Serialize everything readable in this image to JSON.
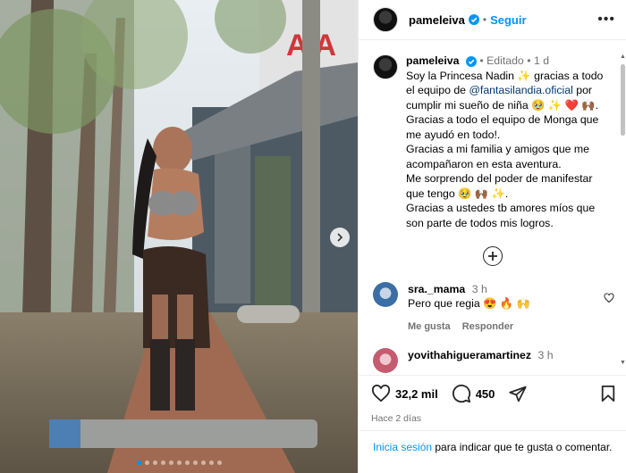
{
  "post": {
    "username": "pameleiva",
    "follow_label": "Seguir",
    "more_label": "•••",
    "edited_label": "Editado",
    "age": "1 d",
    "caption_lines": [
      "Soy la Princesa Nadin ✨ gracias a todo",
      "el equipo de ",
      "@fantasilandia.oficial",
      " por",
      "cumplir mi sueño de niña 🥹 ✨ ❤️ 🙌🏾.",
      "Gracias a todo el equipo de Monga que",
      "me ayudó en todo!.",
      "Gracias a mi familia y amigos que me",
      "acompañaron en esta aventura.",
      "Me sorprendo del poder de manifestar",
      "que tengo 🥹 🙌🏾 ✨.",
      "Gracias a ustedes tb amores míos que",
      "son parte de todos mis logros."
    ]
  },
  "comments": [
    {
      "username": "sra._mama",
      "time": "3 h",
      "text": "Pero que regia 😍 🔥 🙌",
      "like_label": "Me gusta",
      "reply_label": "Responder"
    },
    {
      "username": "yovithahigueramartinez",
      "time": "3 h"
    }
  ],
  "stats": {
    "likes": "32,2 mil",
    "comments": "450",
    "date": "Hace 2 días"
  },
  "login": {
    "link": "Inicia sesión",
    "text": " para indicar que te gusta o comentar."
  },
  "photo": {
    "sign_text": "A  A",
    "carousel_dots": 11,
    "active_dot": 0
  },
  "colors": {
    "accent": "#0095f6",
    "mention": "#00376b",
    "secondary_text": "#737373"
  }
}
